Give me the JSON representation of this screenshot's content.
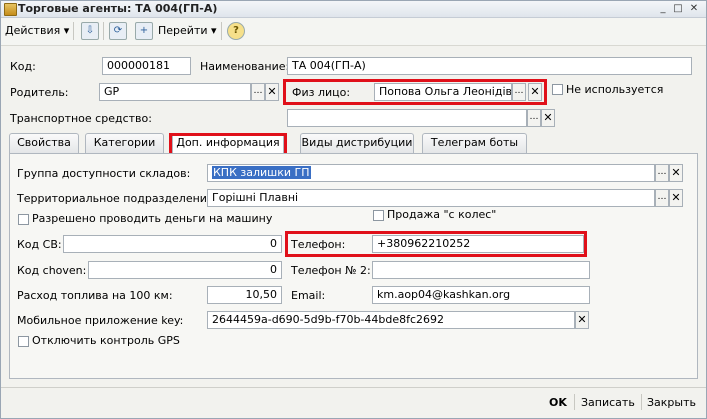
{
  "window": {
    "title": "Торговые агенты: ТА 004(ГП-А)"
  },
  "toolbar": {
    "actions_label": "Действия",
    "goto_label": "Перейти",
    "help_icon": "?"
  },
  "fields": {
    "code_label": "Код:",
    "code_value": "000000181",
    "name_label": "Наименование:",
    "name_value": "ТА 004(ГП-А)",
    "parent_label": "Родитель:",
    "parent_value": "GP",
    "person_label": "Физ лицо:",
    "person_value": "Попова Ольга Леонідівна",
    "not_used_label": "Не используется",
    "vehicle_label": "Транспортное средство:",
    "vehicle_value": ""
  },
  "tabs": [
    {
      "label": "Свойства"
    },
    {
      "label": "Категории"
    },
    {
      "label": "Доп. информация"
    },
    {
      "label": "Виды дистрибуции"
    },
    {
      "label": "Телеграм боты"
    }
  ],
  "panel": {
    "warehouse_group_label": "Группа доступности складов:",
    "warehouse_group_value": "КПК залишки ГП",
    "territory_label": "Территориальное подразделение:",
    "territory_value": "Горішні Плавні",
    "money_to_car_label": "Разрешено проводить деньги на машину",
    "wheels_sale_label": "Продажа \"с колес\"",
    "code_cb_label": "Код СВ:",
    "code_cb_value": "0",
    "phone_label": "Телефон:",
    "phone_value": "+380962210252",
    "code_choven_label": "Код choven:",
    "code_choven_value": "0",
    "phone2_label": "Телефон № 2:",
    "phone2_value": "",
    "fuel_label": "Расход топлива на 100 км:",
    "fuel_value": "10,50",
    "email_label": "Email:",
    "email_value": "km.aop04@kashkan.org",
    "mobile_key_label": "Мобильное приложение key:",
    "mobile_key_value": "2644459a-d690-5d9b-f70b-44bde8fc2692",
    "gps_label": "Отключить контроль GPS"
  },
  "footer": {
    "ok_label": "OK",
    "save_label": "Записать",
    "close_label": "Закрыть"
  }
}
